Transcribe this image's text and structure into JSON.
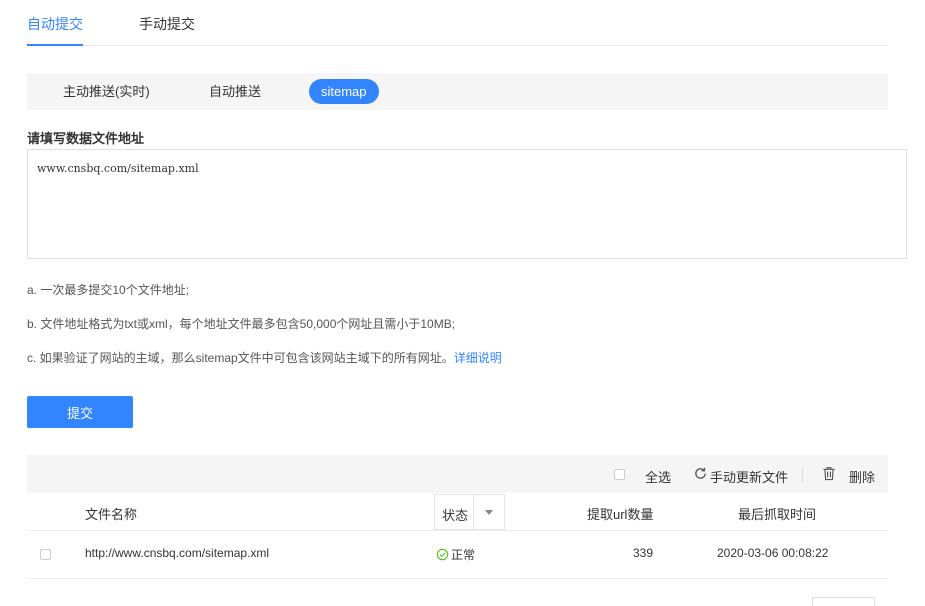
{
  "top_tabs": [
    {
      "label": "自动提交",
      "active": true
    },
    {
      "label": "手动提交",
      "active": false
    }
  ],
  "sub_tabs": [
    {
      "label": "主动推送(实时)",
      "active": false
    },
    {
      "label": "自动推送",
      "active": false
    },
    {
      "label": "sitemap",
      "active": true
    }
  ],
  "form": {
    "label": "请填写数据文件地址",
    "value": "www.cnsbq.com/sitemap.xml",
    "notes": {
      "a": "a. 一次最多提交10个文件地址;",
      "b": "b. 文件地址格式为txt或xml，每个地址文件最多包含50,000个网址且需小于10MB;",
      "c": "c. 如果验证了网站的主域，那么sitemap文件中可包含该网站主域下的所有网址。",
      "c_link": "详细说明"
    },
    "submit_label": "提交"
  },
  "toolbar": {
    "select_all": "全选",
    "refresh": "手动更新文件",
    "delete": "删除"
  },
  "table": {
    "headers": {
      "name": "文件名称",
      "status": "状态",
      "count": "提取url数量",
      "time": "最后抓取时间"
    },
    "rows": [
      {
        "name": "http://www.cnsbq.com/sitemap.xml",
        "status": "正常",
        "count": "339",
        "time": "2020-03-06 00:08:22"
      }
    ]
  },
  "colors": {
    "accent": "#3385ff",
    "status_ok": "#52c41a"
  },
  "icons": {
    "refresh": "refresh-icon",
    "delete": "trash-icon",
    "status": "check-circle-icon",
    "filter": "caret-down-icon"
  }
}
